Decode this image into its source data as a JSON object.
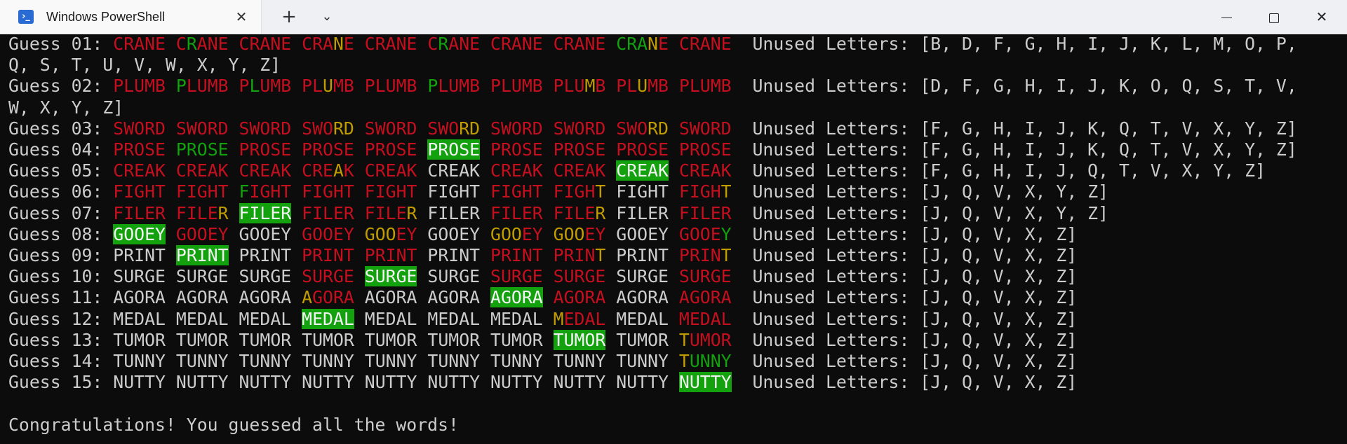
{
  "window": {
    "tab_title": "Windows PowerShell",
    "tab_icon": "powershell-icon",
    "new_tab_label": "+",
    "dropdown_icon": "chevron-down-icon",
    "close_tab_label": "✕",
    "close_window_label": "✕"
  },
  "colors": {
    "red": "#c50f1f",
    "green": "#13a10e",
    "yellow": "#c19c00",
    "white": "#cccccc",
    "background": "#0c0c0c"
  },
  "terminal": {
    "guesses": [
      {
        "label": "Guess 01: ",
        "words": [
          "RrRrYyRrRr",
          "RrRrRrRrRr",
          "RrRrRrRrRr",
          "RrRrRrRrYy",
          "RrRrRrRrRr",
          "RrGgRrRrRr",
          "RrRrRrRrRr",
          "RrRrRrRrRr",
          "GgGgGgYyRr",
          "RrRrRrRrRr"
        ],
        "text": [
          "CRANE",
          "CRANE",
          "CRANE",
          "CRANE",
          "CRANE",
          "CRANE",
          "CRANE",
          "CRANE",
          "CRANE",
          "CRANE"
        ],
        "unused_wrap_1": "Unused Letters: [B, D, F, G, H, I, J, K, L, M, O, P,",
        "unused_wrap_2": "Q, S, T, U, V, W, X, Y, Z]"
      },
      {
        "label": "Guess 02: ",
        "text": [
          "PLUMB",
          "PLUMB",
          "PLUMB",
          "PLUMB",
          "PLUMB",
          "PLUMB",
          "PLUMB",
          "PLUMB",
          "PLUMB",
          "PLUMB"
        ],
        "unused_wrap_1": "Unused Letters: [D, F, G, H, I, J, K, O, Q, S, T, V,",
        "unused_wrap_2": "W, X, Y, Z]"
      },
      {
        "label": "Guess 03: ",
        "text": [
          "SWORD",
          "SWORD",
          "SWORD",
          "SWORD",
          "SWORD",
          "SWORD",
          "SWORD",
          "SWORD",
          "SWORD",
          "SWORD"
        ],
        "unused": "Unused Letters: [F, G, H, I, J, K, Q, T, V, X, Y, Z]"
      },
      {
        "label": "Guess 04: ",
        "text": [
          "PROSE",
          "PROSE",
          "PROSE",
          "PROSE",
          "PROSE",
          "PROSE",
          "PROSE",
          "PROSE",
          "PROSE",
          "PROSE"
        ],
        "unused": "Unused Letters: [F, G, H, I, J, K, Q, T, V, X, Y, Z]"
      },
      {
        "label": "Guess 05: ",
        "text": [
          "CREAK",
          "CREAK",
          "CREAK",
          "CREAK",
          "CREAK",
          "CREAK",
          "CREAK",
          "CREAK",
          "CREAK",
          "CREAK"
        ],
        "unused": "Unused Letters: [F, G, H, I, J, Q, T, V, X, Y, Z]"
      },
      {
        "label": "Guess 06: ",
        "text": [
          "FIGHT",
          "FIGHT",
          "FIGHT",
          "FIGHT",
          "FIGHT",
          "FIGHT",
          "FIGHT",
          "FIGHT",
          "FIGHT",
          "FIGHT"
        ],
        "unused": "Unused Letters: [J, Q, V, X, Y, Z]"
      },
      {
        "label": "Guess 07: ",
        "text": [
          "FILER",
          "FILER",
          "FILER",
          "FILER",
          "FILER",
          "FILER",
          "FILER",
          "FILER",
          "FILER",
          "FILER"
        ],
        "unused": "Unused Letters: [J, Q, V, X, Y, Z]"
      },
      {
        "label": "Guess 08: ",
        "text": [
          "GOOEY",
          "GOOEY",
          "GOOEY",
          "GOOEY",
          "GOOEY",
          "GOOEY",
          "GOOEY",
          "GOOEY",
          "GOOEY",
          "GOOEY"
        ],
        "unused": "Unused Letters: [J, Q, V, X, Z]"
      },
      {
        "label": "Guess 09: ",
        "text": [
          "PRINT",
          "PRINT",
          "PRINT",
          "PRINT",
          "PRINT",
          "PRINT",
          "PRINT",
          "PRINT",
          "PRINT",
          "PRINT"
        ],
        "unused": "Unused Letters: [J, Q, V, X, Z]"
      },
      {
        "label": "Guess 10: ",
        "text": [
          "SURGE",
          "SURGE",
          "SURGE",
          "SURGE",
          "SURGE",
          "SURGE",
          "SURGE",
          "SURGE",
          "SURGE",
          "SURGE"
        ],
        "unused": "Unused Letters: [J, Q, V, X, Z]"
      },
      {
        "label": "Guess 11: ",
        "text": [
          "AGORA",
          "AGORA",
          "AGORA",
          "AGORA",
          "AGORA",
          "AGORA",
          "AGORA",
          "AGORA",
          "AGORA",
          "AGORA"
        ],
        "unused": "Unused Letters: [J, Q, V, X, Z]"
      },
      {
        "label": "Guess 12: ",
        "text": [
          "MEDAL",
          "MEDAL",
          "MEDAL",
          "MEDAL",
          "MEDAL",
          "MEDAL",
          "MEDAL",
          "MEDAL",
          "MEDAL",
          "MEDAL"
        ],
        "unused": "Unused Letters: [J, Q, V, X, Z]"
      },
      {
        "label": "Guess 13: ",
        "text": [
          "TUMOR",
          "TUMOR",
          "TUMOR",
          "TUMOR",
          "TUMOR",
          "TUMOR",
          "TUMOR",
          "TUMOR",
          "TUMOR",
          "TUMOR"
        ],
        "unused": "Unused Letters: [J, Q, V, X, Z]"
      },
      {
        "label": "Guess 14: ",
        "text": [
          "TUNNY",
          "TUNNY",
          "TUNNY",
          "TUNNY",
          "TUNNY",
          "TUNNY",
          "TUNNY",
          "TUNNY",
          "TUNNY",
          "TUNNY"
        ],
        "unused": "Unused Letters: [J, Q, V, X, Z]"
      },
      {
        "label": "Guess 15: ",
        "text": [
          "NUTTY",
          "NUTTY",
          "NUTTY",
          "NUTTY",
          "NUTTY",
          "NUTTY",
          "NUTTY",
          "NUTTY",
          "NUTTY",
          "NUTTY"
        ],
        "unused": "Unused Letters: [J, Q, V, X, Z]"
      }
    ],
    "letter_colors": [
      [
        "rrrrr",
        "rgrrr",
        "rrrrr",
        "rrryr",
        "rrrrr",
        "rgrrr",
        "rrrrr",
        "rrrrr",
        "gggyr",
        "rrrrr"
      ],
      [
        "rrrrr",
        "grrrr",
        "rgrrr",
        "rryrr",
        "rrrrr",
        "grrrr",
        "rrrrr",
        "rrryr",
        "rryrr",
        "rrrrr"
      ],
      [
        "rrrrr",
        "rrrrr",
        "rrrrr",
        "rrryy",
        "rrrrr",
        "rrryy",
        "rrrrr",
        "rrrrr",
        "rrryy",
        "rrrrr"
      ],
      [
        "rrrrr",
        "ggggg",
        "rrrrr",
        "rrrrr",
        "rrrrr",
        "H",
        "rrrrr",
        "rrrrr",
        "rrrrr",
        "rrrrr"
      ],
      [
        "rrrrr",
        "rrrrr",
        "rrrrr",
        "rrryr",
        "rrrrr",
        "wwwww",
        "rrrrr",
        "rrrrr",
        "H",
        "rrrrr"
      ],
      [
        "rrrrr",
        "rrrrr",
        "grrrr",
        "rrrrr",
        "rrrrr",
        "wwwww",
        "rrrrr",
        "rrrry",
        "wwwww",
        "rrrry"
      ],
      [
        "rrrrr",
        "rrrry",
        "H",
        "rrrrr",
        "rrrry",
        "wwwww",
        "rrrrr",
        "rrrry",
        "wwwww",
        "rrrrr"
      ],
      [
        "H",
        "rrrrr",
        "wwwww",
        "rrrrr",
        "yyyrr",
        "wwwww",
        "yyyrr",
        "yyyrr",
        "wwwww",
        "rrrrg"
      ],
      [
        "wwwww",
        "H",
        "wwwww",
        "rrrrr",
        "rrrrr",
        "wwwww",
        "rrrrr",
        "rrrry",
        "wwwww",
        "rrrry"
      ],
      [
        "wwwww",
        "wwwww",
        "wwwww",
        "rrrrr",
        "H",
        "wwwww",
        "rrrrr",
        "rrrrr",
        "wwwww",
        "rrrrr"
      ],
      [
        "wwwww",
        "wwwww",
        "wwwww",
        "yrrrr",
        "wwwww",
        "wwwww",
        "H",
        "rrrrr",
        "wwwww",
        "rrrrr"
      ],
      [
        "wwwww",
        "wwwww",
        "wwwww",
        "H",
        "wwwww",
        "wwwww",
        "wwwww",
        "yrrrr",
        "wwwww",
        "rrrrr"
      ],
      [
        "wwwww",
        "wwwww",
        "wwwww",
        "wwwww",
        "wwwww",
        "wwwww",
        "wwwww",
        "H",
        "wwwww",
        "yrrrr"
      ],
      [
        "wwwww",
        "wwwww",
        "wwwww",
        "wwwww",
        "wwwww",
        "wwwww",
        "wwwww",
        "wwwww",
        "wwwww",
        "ygggg"
      ],
      [
        "wwwww",
        "wwwww",
        "wwwww",
        "wwwww",
        "wwwww",
        "wwwww",
        "wwwww",
        "wwwww",
        "wwwww",
        "H"
      ]
    ],
    "congratulations": "Congratulations! You guessed all the words!"
  }
}
